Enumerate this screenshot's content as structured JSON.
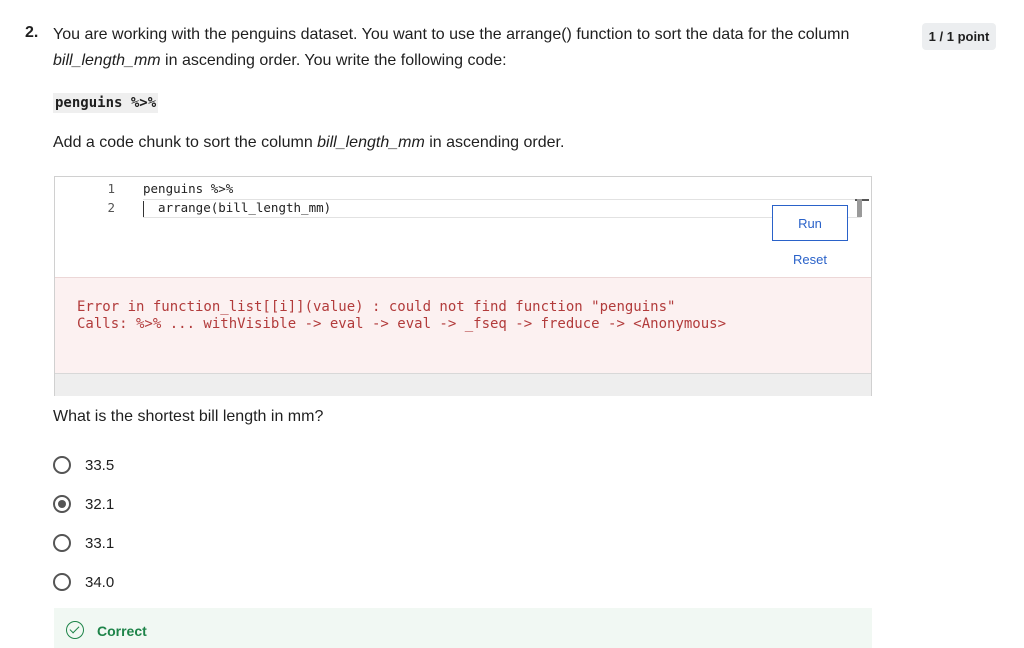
{
  "question": {
    "number": "2.",
    "text_part1": "You are working with the penguins dataset. You want to use the arrange() function to sort the data for the column ",
    "text_em": "bill_length_mm",
    "text_part2": " in ascending order. You write the following code:",
    "score": "1 / 1 point"
  },
  "given_code": "penguins %>%",
  "instruction": {
    "part1": "Add a code chunk to sort the column ",
    "em": "bill_length_mm",
    "part2": " in ascending order."
  },
  "editor": {
    "lines": [
      {
        "number": "1",
        "code": "penguins %>%"
      },
      {
        "number": "2",
        "code": "  arrange(bill_length_mm)"
      }
    ],
    "run_label": "Run",
    "reset_label": "Reset",
    "error_line1": "Error in function_list[[i]](value) : could not find function \"penguins\"",
    "error_line2": "Calls: %>% ... withVisible -> eval -> eval -> _fseq -> freduce -> <Anonymous>"
  },
  "subquestion": "What is the shortest bill length in mm?",
  "options": [
    {
      "label": "33.5",
      "selected": false
    },
    {
      "label": "32.1",
      "selected": true
    },
    {
      "label": "33.1",
      "selected": false
    },
    {
      "label": "34.0",
      "selected": false
    }
  ],
  "feedback": {
    "label": "Correct",
    "icon": "check-circle-icon",
    "color": "#1e8449"
  },
  "colors": {
    "link": "#2a62c9",
    "error_text": "#b23b3b",
    "error_bg": "#fcf1f1"
  }
}
